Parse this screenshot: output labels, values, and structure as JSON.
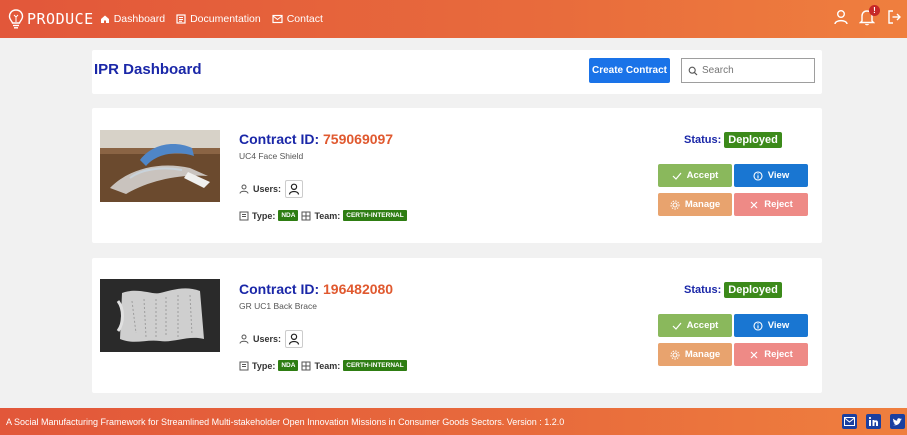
{
  "nav": {
    "brand": "PRODUCE",
    "links": [
      {
        "label": "Dashboard",
        "icon": "home-icon"
      },
      {
        "label": "Documentation",
        "icon": "document-icon"
      },
      {
        "label": "Contact",
        "icon": "mail-icon"
      }
    ],
    "notification_count": "!"
  },
  "header": {
    "title": "IPR Dashboard",
    "create_label": "Create Contract",
    "search_placeholder": "Search"
  },
  "contracts": [
    {
      "id_label": "Contract ID:",
      "id": "759069097",
      "description": "UC4 Face Shield",
      "users_label": "Users:",
      "type_label": "Type:",
      "type": "NDA",
      "team_label": "Team:",
      "team": "CERTH-INTERNAL",
      "status_label": "Status:",
      "status": "Deployed",
      "buttons": {
        "accept": "Accept",
        "view": "View",
        "manage": "Manage",
        "reject": "Reject"
      }
    },
    {
      "id_label": "Contract ID:",
      "id": "196482080",
      "description": "GR UC1 Back Brace",
      "users_label": "Users:",
      "type_label": "Type:",
      "type": "NDA",
      "team_label": "Team:",
      "team": "CERTH-INTERNAL",
      "status_label": "Status:",
      "status": "Deployed",
      "buttons": {
        "accept": "Accept",
        "view": "View",
        "manage": "Manage",
        "reject": "Reject"
      }
    }
  ],
  "footer": {
    "text": "A Social Manufacturing Framework for Streamlined Multi-stakeholder Open Innovation Missions in Consumer Goods Sectors. Version : 1.2.0"
  },
  "colors": {
    "accent": "#e86b3c",
    "title_blue": "#1a27a8",
    "id_orange": "#e0592f",
    "status_green": "#3c8a1a"
  }
}
